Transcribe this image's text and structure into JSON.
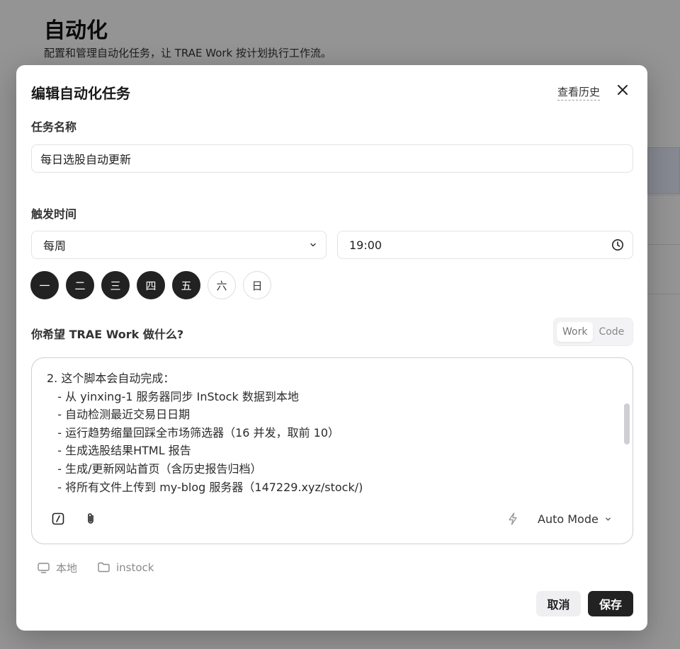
{
  "background": {
    "title": "自动化",
    "subtitle": "配置和管理自动化任务，让 TRAE Work 按计划执行工作流。"
  },
  "modal": {
    "title": "编辑自动化任务",
    "history_link": "查看历史",
    "task_name_label": "任务名称",
    "task_name_value": "每日选股自动更新",
    "trigger_label": "触发时间",
    "frequency_value": "每周",
    "time_value": "19:00",
    "weekdays": [
      {
        "label": "一",
        "selected": true
      },
      {
        "label": "二",
        "selected": true
      },
      {
        "label": "三",
        "selected": true
      },
      {
        "label": "四",
        "selected": true
      },
      {
        "label": "五",
        "selected": true
      },
      {
        "label": "六",
        "selected": false
      },
      {
        "label": "日",
        "selected": false
      }
    ],
    "prompt_label": "你希望 TRAE Work 做什么?",
    "mode_toggle": {
      "work": "Work",
      "code": "Code",
      "active": "Work"
    },
    "prompt_lines": [
      "2. 这个脚本会自动完成：",
      "   - 从 yinxing-1 服务器同步 InStock 数据到本地",
      "   - 自动检测最近交易日日期",
      "   - 运行趋势缩量回踩全市场筛选器（16 并发，取前 10）",
      "   - 生成选股结果HTML 报告",
      "   - 生成/更新网站首页（含历史报告归档）",
      "   - 将所有文件上传到 my-blog 服务器（147229.xyz/stock/)"
    ],
    "auto_mode_label": "Auto Mode",
    "env_local": "本地",
    "env_folder": "instock",
    "cancel_label": "取消",
    "save_label": "保存"
  },
  "icons": [
    "close-icon",
    "chevron-down-icon",
    "clock-icon",
    "slash-command-icon",
    "paperclip-icon",
    "lightning-icon",
    "monitor-icon",
    "folder-icon"
  ]
}
